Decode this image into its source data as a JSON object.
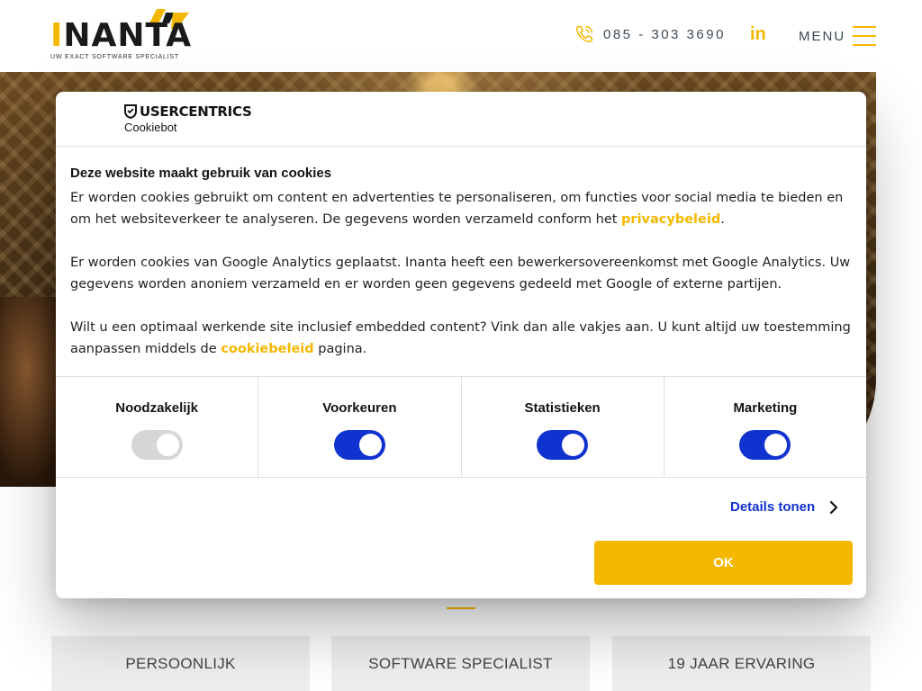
{
  "header": {
    "logo_text_first": "I",
    "logo_text_rest": "NANTA",
    "logo_tagline": "UW EXACT SOFTWARE SPECIALIST",
    "phone": "085 - 303 3690",
    "linkedin": "in",
    "menu_label": "MENU"
  },
  "cookie_dialog": {
    "brand_name": "USERCENTRICS",
    "brand_sub": "Cookiebot",
    "title": "Deze website maakt gebruik van cookies",
    "p1_text": "Er worden cookies gebruikt om content en advertenties te personaliseren, om functies voor social media te bieden en om het websiteverkeer te analyseren. De gegevens worden verzameld conform het ",
    "p1_link": "privacybeleid",
    "p1_end": ".",
    "p2_text": "Er worden cookies van Google Analytics geplaatst. Inanta heeft een bewerkersovereenkomst met Google Analytics. Uw gegevens worden anoniem verzameld en er worden geen gegevens gedeeld met Google of externe partijen.",
    "p3_text": "Wilt u een optimaal werkende site inclusief embedded content? Vink dan alle vakjes aan. U kunt altijd uw toestemming aanpassen middels de ",
    "p3_link": "cookiebeleid",
    "p3_end": " pagina.",
    "toggles": [
      {
        "label": "Noodzakelijk",
        "checked": true,
        "disabled": true
      },
      {
        "label": "Voorkeuren",
        "checked": true,
        "disabled": false
      },
      {
        "label": "Statistieken",
        "checked": true,
        "disabled": false
      },
      {
        "label": "Marketing",
        "checked": true,
        "disabled": false
      }
    ],
    "details_label": "Details tonen",
    "ok_label": "OK"
  },
  "features": [
    "PERSOONLIJK",
    "SOFTWARE SPECIALIST",
    "19 JAAR ERVARING"
  ],
  "colors": {
    "accent": "#f5b800",
    "toggle_on": "#1032cf",
    "toggle_disabled": "#d6d6d6",
    "details_link": "#1032cf"
  }
}
